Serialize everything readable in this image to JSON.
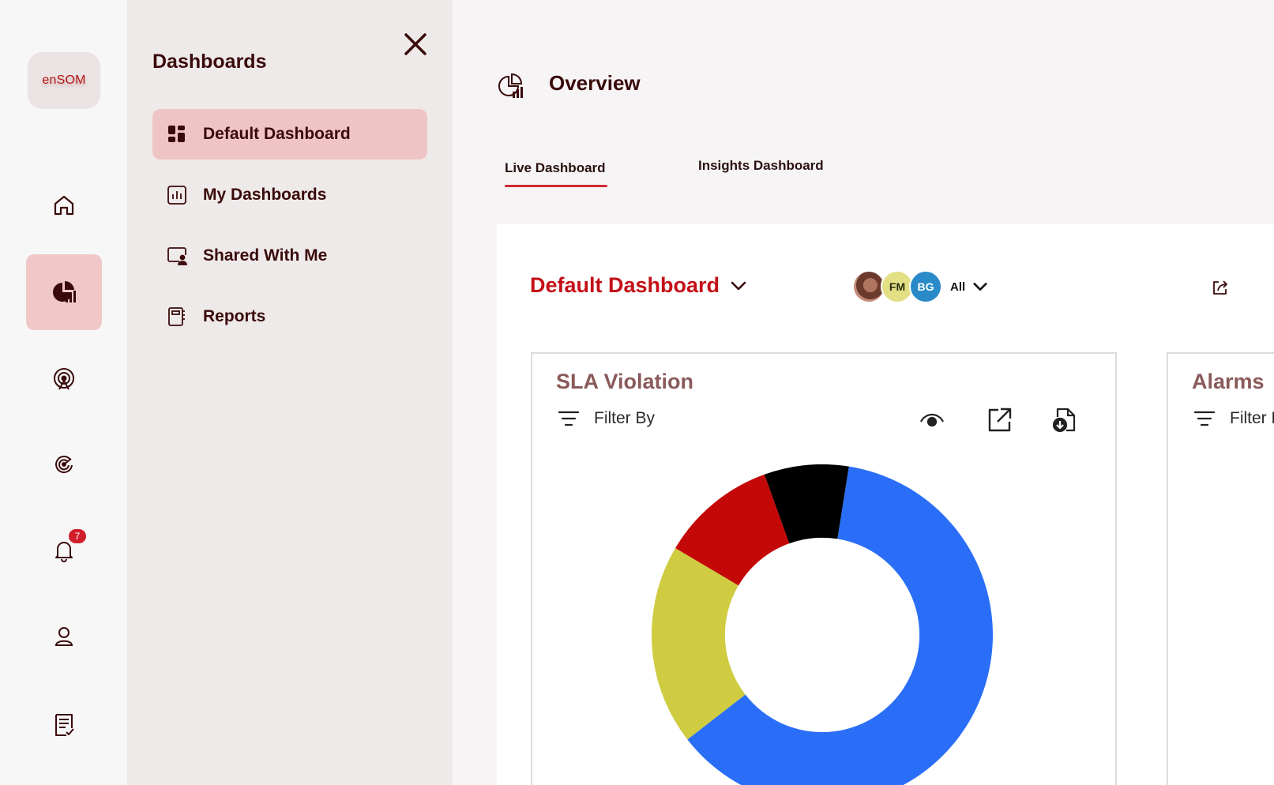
{
  "logo": {
    "text": "enSOM"
  },
  "rail": {
    "items": [
      {
        "name": "home",
        "icon": "home-icon",
        "active": false
      },
      {
        "name": "dashboards",
        "icon": "pie-chart-icon",
        "active": true
      },
      {
        "name": "broadcast",
        "icon": "broadcast-icon",
        "active": false
      },
      {
        "name": "radar",
        "icon": "radar-icon",
        "active": false
      },
      {
        "name": "notifications",
        "icon": "bell-icon",
        "active": false,
        "badge": "7"
      },
      {
        "name": "profile",
        "icon": "user-icon",
        "active": false
      },
      {
        "name": "tasks",
        "icon": "checklist-icon",
        "active": false
      }
    ]
  },
  "drawer": {
    "title": "Dashboards",
    "items": [
      {
        "label": "Default Dashboard",
        "icon": "dashboard-grid-icon",
        "active": true
      },
      {
        "label": "My Dashboards",
        "icon": "bar-chart-icon",
        "active": false
      },
      {
        "label": "Shared With Me",
        "icon": "shared-screen-icon",
        "active": false
      },
      {
        "label": "Reports",
        "icon": "report-icon",
        "active": false
      }
    ]
  },
  "main": {
    "title": "Overview",
    "tabs": [
      {
        "label": "Live Dashboard",
        "active": true
      },
      {
        "label": "Insights Dashboard",
        "active": false
      }
    ],
    "dashboard_select": "Default Dashboard",
    "members": [
      "FM",
      "BG"
    ],
    "members_filter": "All"
  },
  "widgets": [
    {
      "title": "SLA Violation",
      "filter_label": "Filter By"
    },
    {
      "title": "Alarms",
      "filter_label": "Filter By"
    }
  ],
  "colors": {
    "accent": "#c40f17",
    "active_bg": "#efc4c4",
    "tab_underline": "#d12a33"
  },
  "chart_data": {
    "type": "pie",
    "title": "SLA Violation",
    "slices": [
      {
        "value": 62,
        "color": "#2a6ef8"
      },
      {
        "value": 19,
        "color": "#cfcc42"
      },
      {
        "value": 11,
        "color": "#c40707"
      },
      {
        "value": 8,
        "color": "#000000"
      }
    ],
    "start_angle_deg": 9,
    "inner_radius_ratio": 0.57
  }
}
